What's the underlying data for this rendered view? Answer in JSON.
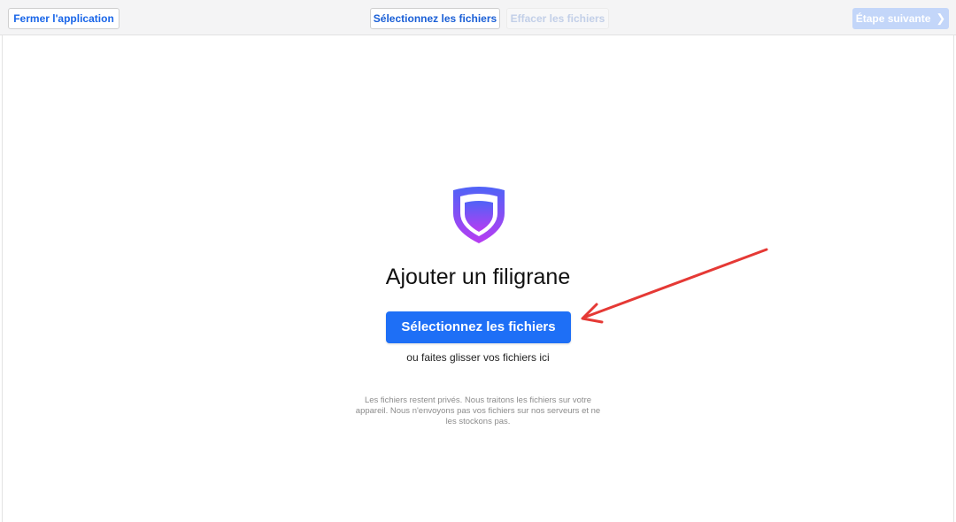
{
  "toolbar": {
    "close_app_label": "Fermer l'application",
    "select_files_label": "Sélectionnez les fichiers",
    "clear_files_label": "Effacer les fichiers",
    "next_step_label": "Étape suivante",
    "next_icon": "chevron-right-icon"
  },
  "main": {
    "logo_icon": "shield-icon",
    "title": "Ajouter un filigrane",
    "select_button_label": "Sélectionnez les fichiers",
    "drop_hint": "ou faites glisser vos fichiers ici",
    "privacy_note": "Les fichiers restent privés. Nous traitons les fichiers sur votre appareil. Nous n'envoyons pas vos fichiers sur nos serveurs et ne les stockons pas."
  },
  "annotation": {
    "arrow_color": "#e53935"
  },
  "colors": {
    "accent": "#1e6ff6",
    "shield_gradient_top": "#5b5cf6",
    "shield_gradient_bottom": "#b23cf0"
  }
}
